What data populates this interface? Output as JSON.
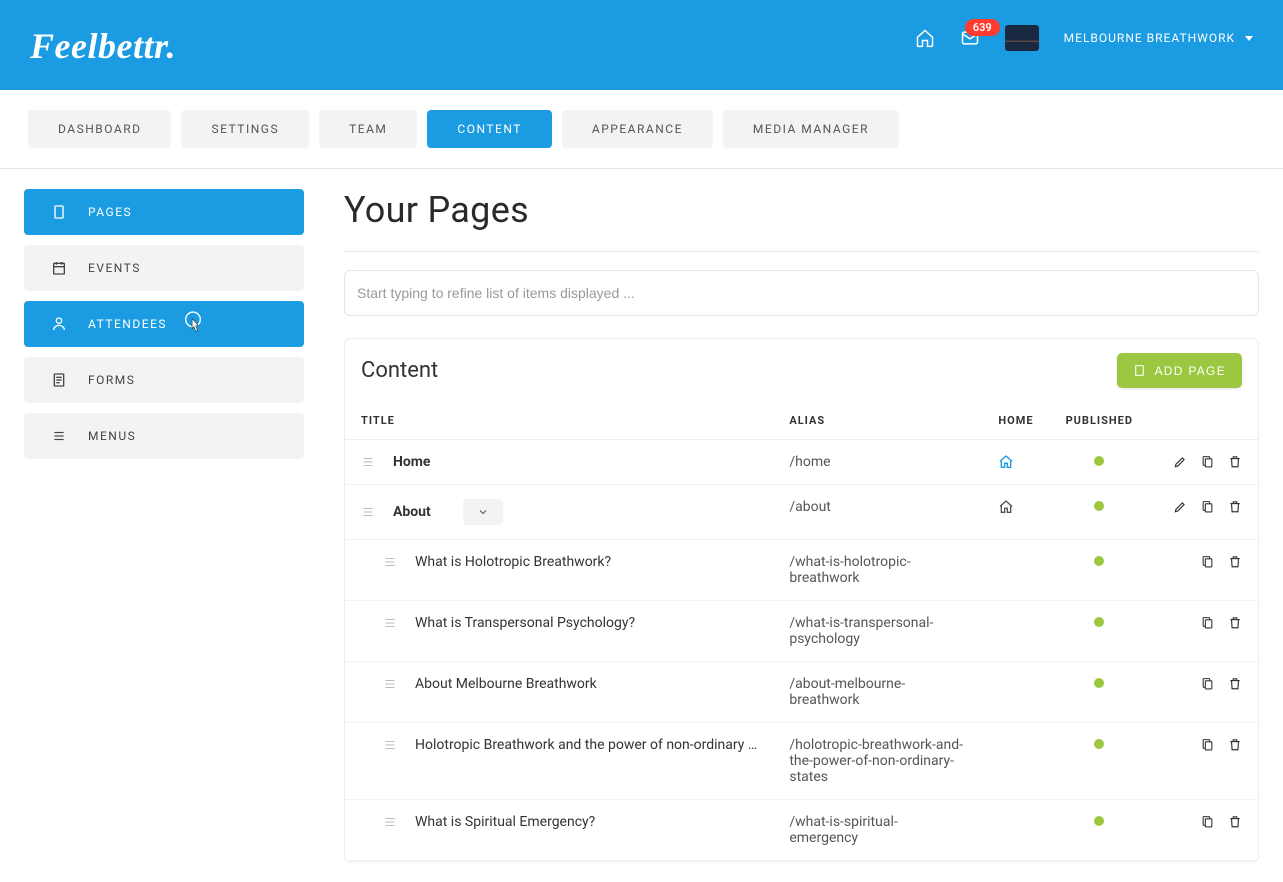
{
  "brand": "Feelbettr.",
  "header": {
    "messages_badge": "639",
    "account_name": "MELBOURNE BREATHWORK"
  },
  "tabs": [
    {
      "label": "DASHBOARD",
      "active": false
    },
    {
      "label": "SETTINGS",
      "active": false
    },
    {
      "label": "TEAM",
      "active": false
    },
    {
      "label": "CONTENT",
      "active": true
    },
    {
      "label": "APPEARANCE",
      "active": false
    },
    {
      "label": "MEDIA MANAGER",
      "active": false
    }
  ],
  "sidebar": [
    {
      "label": "PAGES",
      "icon": "document",
      "active": true
    },
    {
      "label": "EVENTS",
      "icon": "calendar",
      "active": false
    },
    {
      "label": "ATTENDEES",
      "icon": "person",
      "active": true,
      "hover": true
    },
    {
      "label": "FORMS",
      "icon": "form",
      "active": false
    },
    {
      "label": "MENUS",
      "icon": "menu",
      "active": false
    }
  ],
  "page": {
    "title": "Your Pages",
    "search_placeholder": "Start typing to refine list of items displayed ...",
    "section_title": "Content",
    "add_button": "ADD PAGE",
    "columns": {
      "title": "TITLE",
      "alias": "ALIAS",
      "home": "HOME",
      "published": "PUBLISHED"
    },
    "rows": [
      {
        "level": 0,
        "title": "Home",
        "alias": "/home",
        "bold": true,
        "expandable": false,
        "isHome": true,
        "homeColor": "blue",
        "published": true,
        "actions": [
          "edit",
          "copy",
          "delete"
        ]
      },
      {
        "level": 0,
        "title": "About",
        "alias": "/about",
        "bold": true,
        "expandable": true,
        "isHome": true,
        "homeColor": "gray",
        "published": true,
        "actions": [
          "edit",
          "copy",
          "delete"
        ]
      },
      {
        "level": 1,
        "title": "What is Holotropic Breathwork?",
        "alias": "/what-is-holotropic-breathwork",
        "bold": false,
        "expandable": false,
        "isHome": false,
        "published": true,
        "actions": [
          "copy",
          "delete"
        ]
      },
      {
        "level": 1,
        "title": "What is Transpersonal Psychology?",
        "alias": "/what-is-transpersonal-psychology",
        "bold": false,
        "expandable": false,
        "isHome": false,
        "published": true,
        "actions": [
          "copy",
          "delete"
        ]
      },
      {
        "level": 1,
        "title": "About Melbourne Breathwork",
        "alias": "/about-melbourne-breathwork",
        "bold": false,
        "expandable": false,
        "isHome": false,
        "published": true,
        "actions": [
          "copy",
          "delete"
        ]
      },
      {
        "level": 1,
        "title": "Holotropic Breathwork and the power of non-ordinary …",
        "alias": "/holotropic-breathwork-and-the-power-of-non-ordinary-states",
        "bold": false,
        "expandable": false,
        "isHome": false,
        "published": true,
        "actions": [
          "copy",
          "delete"
        ]
      },
      {
        "level": 1,
        "title": "What is Spiritual Emergency?",
        "alias": "/what-is-spiritual-emergency",
        "bold": false,
        "expandable": false,
        "isHome": false,
        "published": true,
        "actions": [
          "copy",
          "delete"
        ]
      }
    ]
  }
}
